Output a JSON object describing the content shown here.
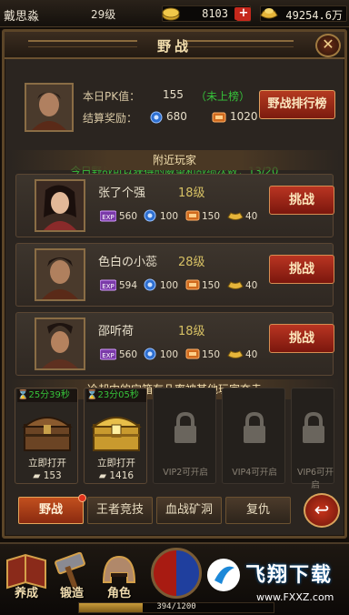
{
  "top": {
    "player_name": "戴思淼",
    "player_level": "29级",
    "gold": "8103",
    "ingot": "49254.6万",
    "plus": "+"
  },
  "panel": {
    "title": "野战",
    "close": "✕",
    "pk_label": "本日PK值：",
    "pk_value": "155",
    "pk_rank_status": "（未上榜）",
    "reward_label": "结算奖励：",
    "reward_prestige": "680",
    "reward_merit": "1020",
    "rank_button": "野战排行榜",
    "note": "今日野战可以获得的威望和战绩次数：13/20",
    "nearby_title": "附近玩家",
    "chest_title": "冷却中的宝箱有几率被其他玩家夺走"
  },
  "players": [
    {
      "name": "张了个强",
      "level": "18级",
      "exp": "560",
      "blue": "100",
      "orange": "150",
      "gold": "40",
      "button": "挑战"
    },
    {
      "name": "色白の小蕊",
      "level": "28级",
      "exp": "594",
      "blue": "100",
      "orange": "150",
      "gold": "40",
      "button": "挑战"
    },
    {
      "name": "邵听荷",
      "level": "18级",
      "exp": "560",
      "blue": "100",
      "orange": "150",
      "gold": "40",
      "button": "挑战"
    }
  ],
  "chests": [
    {
      "timer": "25分39秒",
      "open": "立即打开",
      "cost": "153"
    },
    {
      "timer": "23分05秒",
      "open": "立即打开",
      "cost": "1416"
    },
    {
      "lock": "VIP2可开启"
    },
    {
      "lock": "VIP4可开启"
    },
    {
      "lock": "VIP6可开启"
    }
  ],
  "tabs": [
    "野战",
    "王者竞技",
    "血战矿洞",
    "复仇"
  ],
  "bottom_menu": [
    "养成",
    "锻造",
    "角色"
  ],
  "exp": {
    "text": "394/1200",
    "fraction": 0.328
  },
  "watermark": {
    "title": "飞翔下载",
    "url": "www.FXXZ.com"
  },
  "colors": {
    "green": "#36c23a",
    "red_button": "#b93522",
    "gold_text": "#f3dfae"
  }
}
